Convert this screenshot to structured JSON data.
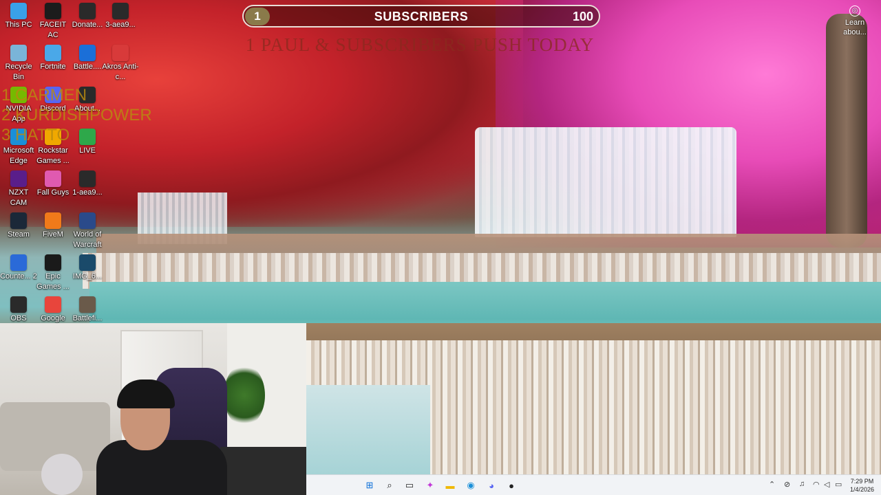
{
  "overlay": {
    "current_subscribers": "1",
    "label": "SUBSCRIBERS",
    "goal": "100",
    "banner": "1 PAUL & SUBSCRIBERS PUSH TODAY",
    "leaderboard": [
      "1 CARMEN",
      "2 KURDISHPOWER",
      "3 HATTO"
    ]
  },
  "desktop_icons": [
    {
      "label": "This PC",
      "icon": "monitor-icon",
      "color": "#3aa0e8"
    },
    {
      "label": "FACEIT AC",
      "icon": "faceit-icon",
      "color": "#1c1c1c"
    },
    {
      "label": "Donate...",
      "icon": "donate-icon",
      "color": "#2a2a2a"
    },
    {
      "label": "3-aea9...",
      "icon": "file-icon",
      "color": "#2a2a2a"
    },
    {
      "label": "Recycle Bin",
      "icon": "recycle-bin-icon",
      "color": "#7ab4d8"
    },
    {
      "label": "Fortnite",
      "icon": "fortnite-icon",
      "color": "#4aa8e8"
    },
    {
      "label": "Battle....",
      "icon": "battlenet-icon",
      "color": "#1b6fd8"
    },
    {
      "label": "Akros Anti-c...",
      "icon": "akros-icon",
      "color": "#d83a3a"
    },
    {
      "label": "NVIDIA App",
      "icon": "nvidia-icon",
      "color": "#76b900"
    },
    {
      "label": "Discord",
      "icon": "discord-icon",
      "color": "#5865f2"
    },
    {
      "label": "About...",
      "icon": "file-icon",
      "color": "#2a2a2a"
    },
    {
      "label": "Microsoft Edge",
      "icon": "edge-icon",
      "color": "#1a8fd8"
    },
    {
      "label": "Rockstar Games ...",
      "icon": "rockstar-icon",
      "color": "#f0a800"
    },
    {
      "label": "LIVE",
      "icon": "live-icon",
      "color": "#2ea84a"
    },
    {
      "label": "NZXT CAM",
      "icon": "nzxt-icon",
      "color": "#5a1e8a"
    },
    {
      "label": "Fall Guys",
      "icon": "fallguys-icon",
      "color": "#e05ab0"
    },
    {
      "label": "1-aea9...",
      "icon": "file-icon",
      "color": "#2a2a2a"
    },
    {
      "label": "Steam",
      "icon": "steam-icon",
      "color": "#1b2838"
    },
    {
      "label": "FiveM",
      "icon": "fivem-icon",
      "color": "#f07a1a"
    },
    {
      "label": "World of Warcraft",
      "icon": "wow-icon",
      "color": "#2a4a8a"
    },
    {
      "label": "Counte... 2",
      "icon": "cs2-icon",
      "color": "#2a6ad8"
    },
    {
      "label": "Epic Games ...",
      "icon": "epic-icon",
      "color": "#1a1a1a"
    },
    {
      "label": "IMG_6...",
      "icon": "image-icon",
      "color": "#1a4a6a"
    },
    {
      "label": "OBS",
      "icon": "obs-icon",
      "color": "#2a2a2a"
    },
    {
      "label": "Google",
      "icon": "chrome-icon",
      "color": "#e8453c"
    },
    {
      "label": "Battlefi...",
      "icon": "battlefield-icon",
      "color": "#6a5a4a"
    }
  ],
  "learn_about": "Learn abou...",
  "taskbar": {
    "apps": [
      {
        "name": "start-button",
        "glyph": "⊞",
        "color": "#0a6ed8"
      },
      {
        "name": "search-button",
        "glyph": "⌕",
        "color": "#222"
      },
      {
        "name": "task-view-button",
        "glyph": "▭",
        "color": "#222"
      },
      {
        "name": "copilot-button",
        "glyph": "✦",
        "color": "#c23ad8"
      },
      {
        "name": "file-explorer-button",
        "glyph": "▬",
        "color": "#f0b800"
      },
      {
        "name": "edge-button",
        "glyph": "◉",
        "color": "#1a8fd8"
      },
      {
        "name": "discord-button",
        "glyph": "◕",
        "color": "#5865f2"
      },
      {
        "name": "obs-button",
        "glyph": "●",
        "color": "#222"
      }
    ],
    "time": "7:29 PM",
    "date": "1/4/2026"
  }
}
